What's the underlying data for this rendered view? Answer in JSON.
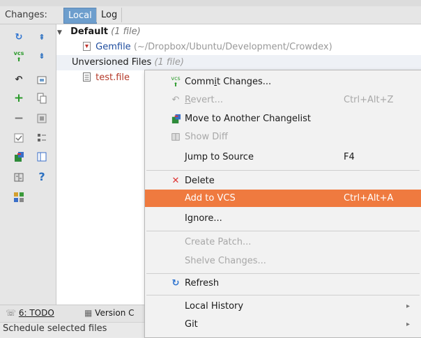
{
  "header": {
    "changes_label": "Changes:",
    "tabs": [
      {
        "label": "Local",
        "active": true
      },
      {
        "label": "Log",
        "active": false
      }
    ]
  },
  "tree": {
    "default_group": {
      "name": "Default",
      "count": "(1 file)"
    },
    "files": [
      {
        "name": "Gemfile",
        "path": "(~/Dropbox/Ubuntu/Development/Crowdex)"
      }
    ],
    "unversioned_group": {
      "name": "Unversioned Files",
      "count": "(1 file)"
    },
    "unversioned_files": [
      {
        "name": "test.file"
      }
    ]
  },
  "toolbar_icons": {
    "left": [
      "refresh-icon",
      "vcs-commit-icon",
      "revert-icon",
      "add-icon",
      "remove-icon",
      "checkbox-icon",
      "move-changelist-icon",
      "show-diff-icon",
      "group-icon"
    ],
    "right": [
      "expand-all-icon",
      "collapse-all-icon",
      "changelist-icon",
      "copy-icon",
      "ignore-icon",
      "group-by-icon",
      "preview-icon",
      "help-icon"
    ]
  },
  "menu": {
    "items": [
      {
        "label": "Commit Changes...",
        "underline": "i",
        "pre": "Comm",
        "post": "t Changes...",
        "shortcut": "",
        "icon": "vcs-commit-icon",
        "disabled": false
      },
      {
        "label": "Revert...",
        "pre": "",
        "underline": "R",
        "post": "evert...",
        "shortcut": "Ctrl+Alt+Z",
        "icon": "revert-icon",
        "disabled": true
      },
      {
        "label": "Move to Another Changelist",
        "shortcut": "",
        "icon": "move-changelist-icon",
        "disabled": false
      },
      {
        "label": "Show Diff",
        "shortcut": "",
        "icon": "show-diff-icon",
        "disabled": true
      },
      {
        "label": "Jump to Source",
        "shortcut": "F4",
        "icon": "",
        "disabled": false
      },
      {
        "label": "Delete",
        "shortcut": "",
        "icon": "delete-icon",
        "disabled": false
      },
      {
        "label": "Add to VCS",
        "shortcut": "Ctrl+Alt+A",
        "icon": "",
        "disabled": false,
        "selected": true
      },
      {
        "label": "Ignore...",
        "shortcut": "",
        "icon": "",
        "disabled": false
      },
      {
        "label": "Create Patch...",
        "shortcut": "",
        "icon": "",
        "disabled": true
      },
      {
        "label": "Shelve Changes...",
        "shortcut": "",
        "icon": "",
        "disabled": true
      },
      {
        "label": "Refresh",
        "shortcut": "",
        "icon": "refresh-icon",
        "disabled": false
      },
      {
        "label": "Local History",
        "shortcut": "",
        "icon": "",
        "disabled": false,
        "submenu": true
      },
      {
        "label": "Git",
        "shortcut": "",
        "icon": "",
        "disabled": false,
        "submenu": true
      }
    ]
  },
  "bottom": {
    "todo_tab": "6: TODO",
    "version_tab": "Version C",
    "status": "Schedule selected files"
  },
  "colors": {
    "selection": "#ef7a3f",
    "active_tab": "#6d9ecd",
    "link_blue": "#1e4c9e",
    "unversioned_red": "#b53a2a"
  }
}
